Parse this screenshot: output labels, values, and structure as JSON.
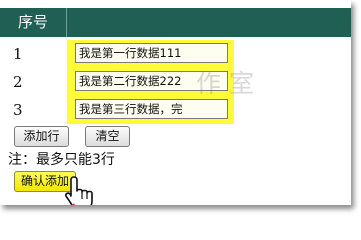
{
  "table": {
    "header": {
      "index": "序号",
      "data": ""
    },
    "rows": [
      {
        "index": "1",
        "value": "我是第一行数据111"
      },
      {
        "index": "2",
        "value": "我是第二行数据222"
      },
      {
        "index": "3",
        "value": "我是第三行数据，完"
      }
    ]
  },
  "buttons": {
    "add_row": "添加行",
    "clear": "清空",
    "confirm": "确认添加"
  },
  "note": "注：最多只能3行",
  "watermark": "作室",
  "colors": {
    "header_bg": "#1f5f54",
    "highlight": "#fffb3a",
    "confirm_button": "#f7ee1a"
  },
  "icons": {
    "cursor": "hand-pointer-icon"
  }
}
